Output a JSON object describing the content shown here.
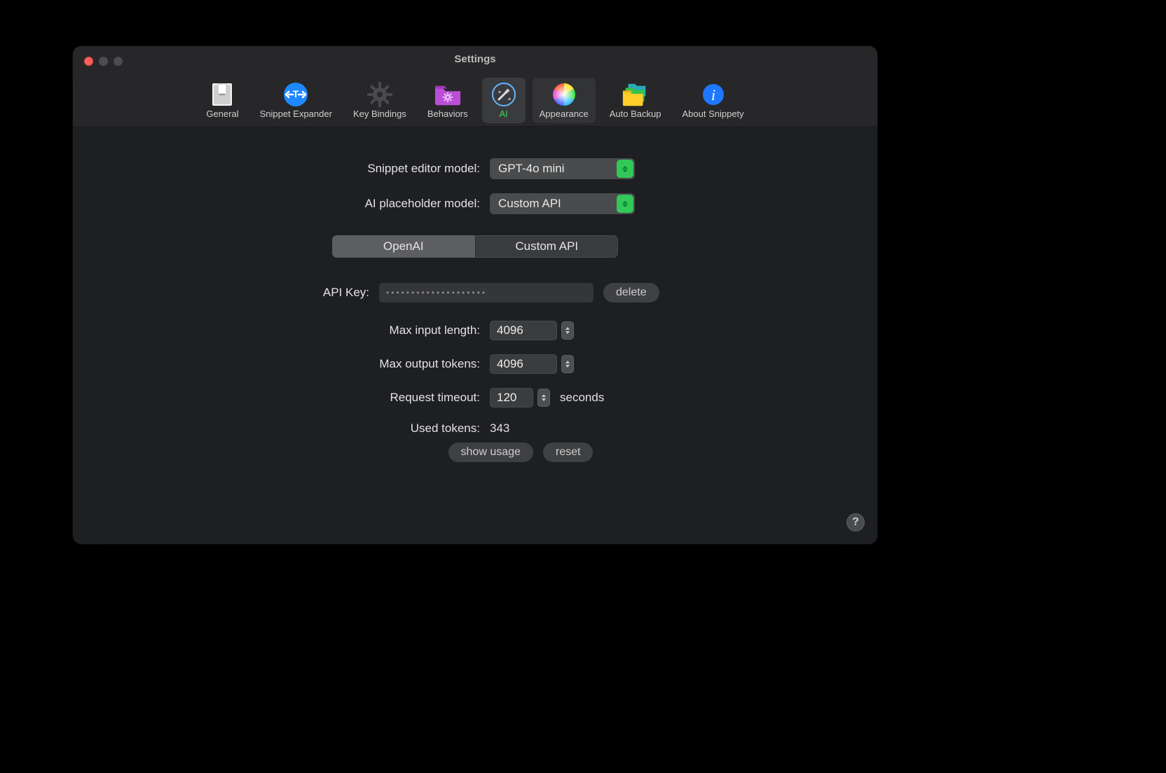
{
  "window": {
    "title": "Settings"
  },
  "tabs": {
    "general": {
      "label": "General"
    },
    "snippet_expander": {
      "label": "Snippet Expander"
    },
    "key_bindings": {
      "label": "Key Bindings"
    },
    "behaviors": {
      "label": "Behaviors"
    },
    "ai": {
      "label": "AI"
    },
    "appearance": {
      "label": "Appearance"
    },
    "auto_backup": {
      "label": "Auto Backup"
    },
    "about": {
      "label": "About Snippety"
    }
  },
  "form": {
    "snippet_editor_model": {
      "label": "Snippet editor model:",
      "value": "GPT-4o mini"
    },
    "ai_placeholder_model": {
      "label": "AI placeholder model:",
      "value": "Custom API"
    },
    "segmented": {
      "openai": "OpenAI",
      "custom": "Custom API"
    },
    "api_key": {
      "label": "API Key:",
      "value": "••••••••••••••••••••",
      "delete": "delete"
    },
    "max_input_length": {
      "label": "Max input length:",
      "value": "4096"
    },
    "max_output_tokens": {
      "label": "Max output tokens:",
      "value": "4096"
    },
    "request_timeout": {
      "label": "Request timeout:",
      "value": "120",
      "suffix": "seconds"
    },
    "used_tokens": {
      "label": "Used tokens:",
      "value": "343"
    },
    "buttons": {
      "show_usage": "show usage",
      "reset": "reset"
    }
  },
  "help": {
    "label": "?"
  }
}
